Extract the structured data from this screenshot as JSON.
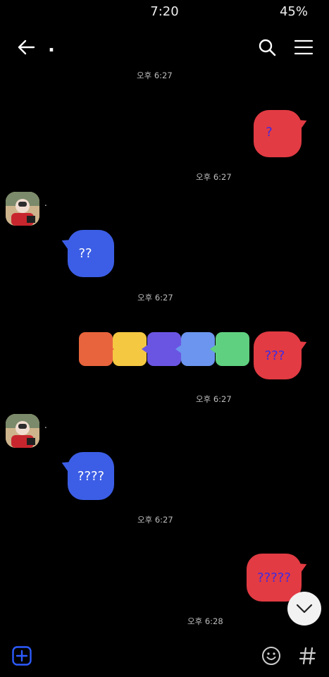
{
  "status": {
    "time": "7:20",
    "battery": "45%"
  },
  "header": {
    "title": "."
  },
  "messages": [
    {
      "side": "me",
      "text": "?",
      "time": "오후 6:27"
    },
    {
      "side": "them",
      "sender": ".",
      "text": "??",
      "time": "오후 6:27"
    },
    {
      "side": "me",
      "text": "???",
      "time": "오후 6:27"
    },
    {
      "side": "them",
      "sender": ".",
      "text": "????",
      "time": "오후 6:27"
    },
    {
      "side": "me",
      "text": "?????",
      "time": "오후 6:28"
    }
  ],
  "top_partial_time": "오후 6:27",
  "chip_colors": [
    "#e8643c",
    "#f5c842",
    "#6a55e3",
    "#6b95ee",
    "#5fd07f"
  ],
  "colors": {
    "my_bubble": "#e23b43",
    "their_bubble": "#3c5ee6",
    "accent": "#2d5bff"
  }
}
